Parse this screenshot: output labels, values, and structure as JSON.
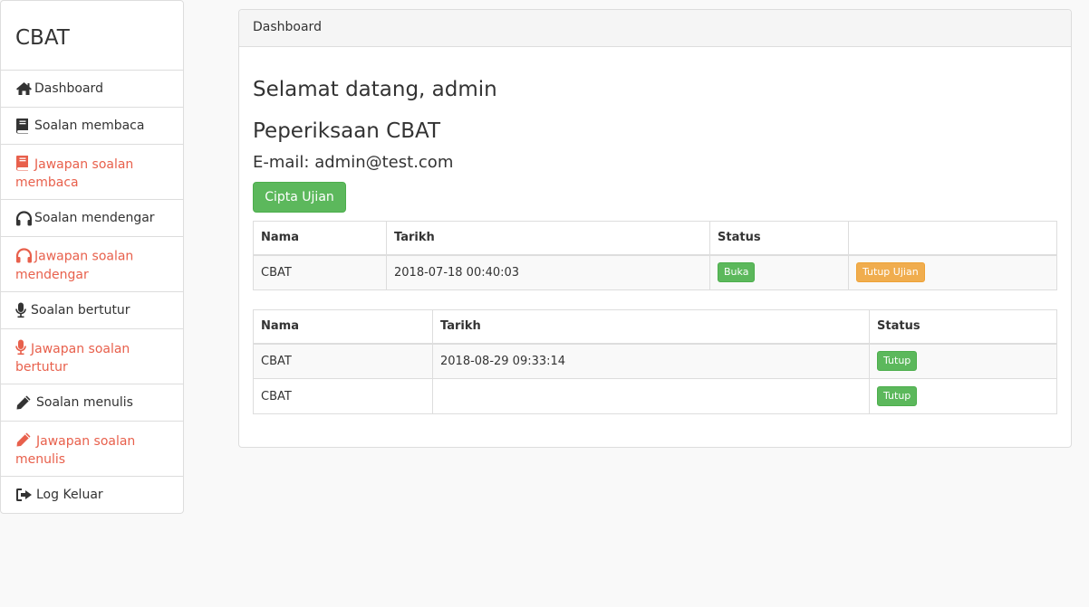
{
  "sidebar": {
    "brand": "CBAT",
    "items": [
      {
        "label": "Dashboard",
        "icon": "home-icon"
      },
      {
        "label": "Soalan membaca",
        "icon": "book-icon"
      },
      {
        "label": "Jawapan soalan membaca",
        "icon": "book-icon"
      },
      {
        "label": "Soalan mendengar",
        "icon": "headphones-icon"
      },
      {
        "label": "Jawapan soalan mendengar",
        "icon": "headphones-icon"
      },
      {
        "label": "Soalan bertutur",
        "icon": "microphone-icon"
      },
      {
        "label": "Jawapan soalan bertutur",
        "icon": "microphone-icon"
      },
      {
        "label": "Soalan menulis",
        "icon": "pencil-icon"
      },
      {
        "label": "Jawapan soalan menulis",
        "icon": "pencil-icon"
      },
      {
        "label": "Log Keluar",
        "icon": "sign-out-icon"
      }
    ]
  },
  "panel": {
    "heading": "Dashboard",
    "welcome": "Selamat datang, admin",
    "exam_title": "Peperiksaan CBAT",
    "email": "E-mail: admin@test.com",
    "create_button": "Cipta Ujian"
  },
  "table1": {
    "headers": [
      "Nama",
      "Tarikh",
      "Status",
      ""
    ],
    "rows": [
      {
        "nama": "CBAT",
        "tarikh": "2018-07-18 00:40:03",
        "status": "Buka",
        "action": "Tutup Ujian"
      }
    ]
  },
  "table2": {
    "headers": [
      "Nama",
      "Tarikh",
      "Status"
    ],
    "rows": [
      {
        "nama": "CBAT",
        "tarikh": "2018-08-29 09:33:14",
        "status": "Tutup"
      },
      {
        "nama": "CBAT",
        "tarikh": "",
        "status": "Tutup"
      }
    ]
  },
  "colors": {
    "accent_red": "#e8604c",
    "success_green": "#5cb85c",
    "warning_orange": "#f0ad4e"
  }
}
